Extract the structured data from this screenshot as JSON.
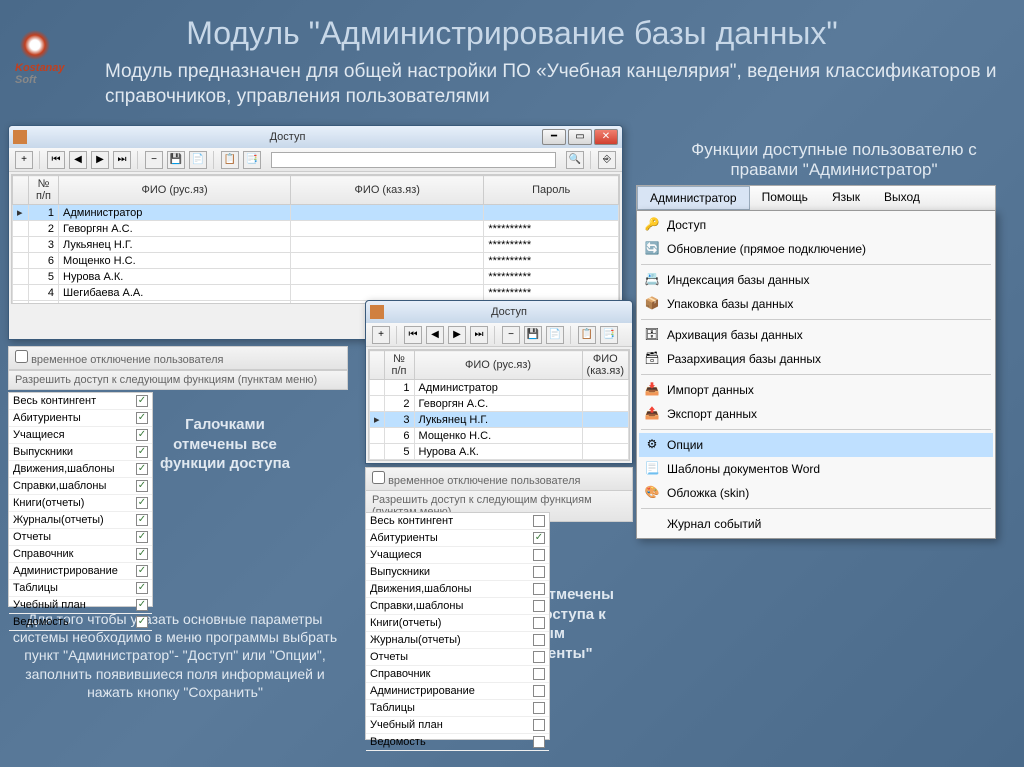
{
  "slide": {
    "title": "Модуль \"Администрирование базы данных\"",
    "desc": "Модуль предназначен для общей настройки ПО «Учебная канцелярия\", ведения классификаторов и справочников, управления пользователями",
    "func_label": "Функции доступные пользователю с правами \"Администратор\"",
    "ann1": "Галочками отмечены все функции доступа",
    "ann2": "Галочками отмечены функции доступа к данным \"Абитуриенты\"",
    "ann3": "Для того чтобы указать основные параметры системы необходимо в меню программы выбрать пункт \"Администратор\"- \"Доступ\" или \"Опции\", заполнить появившиеся поля информацией и нажать кнопку \"Сохранить\"",
    "logo1": "Kostanay",
    "logo2": "Soft"
  },
  "window_title": "Доступ",
  "toolbar": {
    "add": "+",
    "first": "⏮",
    "prev": "◀",
    "next": "▶",
    "last": "⏭",
    "del": "−",
    "save": "💾",
    "doc1": "📄",
    "doc2": "📋",
    "doc3": "📑",
    "search": "🔍",
    "exit": "⎆"
  },
  "grid": {
    "col_num": "№ п/п",
    "col_fio_ru": "ФИО (рус.яз)",
    "col_fio_kz": "ФИО (каз.яз)",
    "col_pass": "Пароль",
    "rows": [
      {
        "n": "1",
        "fio": "Администратор",
        "pass": ""
      },
      {
        "n": "2",
        "fio": "Геворгян А.С.",
        "pass": "**********"
      },
      {
        "n": "3",
        "fio": "Лукьянец Н.Г.",
        "pass": "**********"
      },
      {
        "n": "6",
        "fio": "Мощенко Н.С.",
        "pass": "**********"
      },
      {
        "n": "5",
        "fio": "Нурова А.К.",
        "pass": "**********"
      },
      {
        "n": "4",
        "fio": "Шегибаева А.А.",
        "pass": "**********"
      }
    ]
  },
  "section_temp_disable": "временное отключение пользователя",
  "section_perm": "Разрешить доступ к следующим функциям (пунктам меню)",
  "perms": [
    "Весь контингент",
    "Абитуриенты",
    "Учащиеся",
    "Выпускники",
    "Движения,шаблоны",
    "Справки,шаблоны",
    "Книги(отчеты)",
    "Журналы(отчеты)",
    "Отчеты",
    "Справочник",
    "Администрирование",
    "Таблицы",
    "Учебный план",
    "Ведомость"
  ],
  "perms1_checked": [
    true,
    true,
    true,
    true,
    true,
    true,
    true,
    true,
    true,
    true,
    true,
    true,
    true,
    true
  ],
  "perms2_checked": [
    false,
    true,
    false,
    false,
    false,
    false,
    false,
    false,
    false,
    false,
    false,
    false,
    false,
    false
  ],
  "menubar": [
    "Администратор",
    "Помощь",
    "Язык",
    "Выход"
  ],
  "dropdown": [
    {
      "icon": "🔑",
      "label": "Доступ"
    },
    {
      "icon": "🔄",
      "label": "Обновление (прямое подключение)"
    },
    {
      "sep": true
    },
    {
      "icon": "📇",
      "label": "Индексация базы данных"
    },
    {
      "icon": "📦",
      "label": "Упаковка базы данных"
    },
    {
      "sep": true
    },
    {
      "icon": "🗄",
      "label": "Архивация базы данных"
    },
    {
      "icon": "🗃",
      "label": "Разархивация базы данных"
    },
    {
      "sep": true
    },
    {
      "icon": "📥",
      "label": "Импорт данных"
    },
    {
      "icon": "📤",
      "label": "Экспорт данных"
    },
    {
      "sep": true
    },
    {
      "icon": "⚙",
      "label": "Опции",
      "hl": true
    },
    {
      "icon": "📃",
      "label": "Шаблоны документов Word"
    },
    {
      "icon": "🎨",
      "label": "Обложка (skin)"
    },
    {
      "sep": true
    },
    {
      "icon": "",
      "label": "Журнал событий"
    }
  ]
}
